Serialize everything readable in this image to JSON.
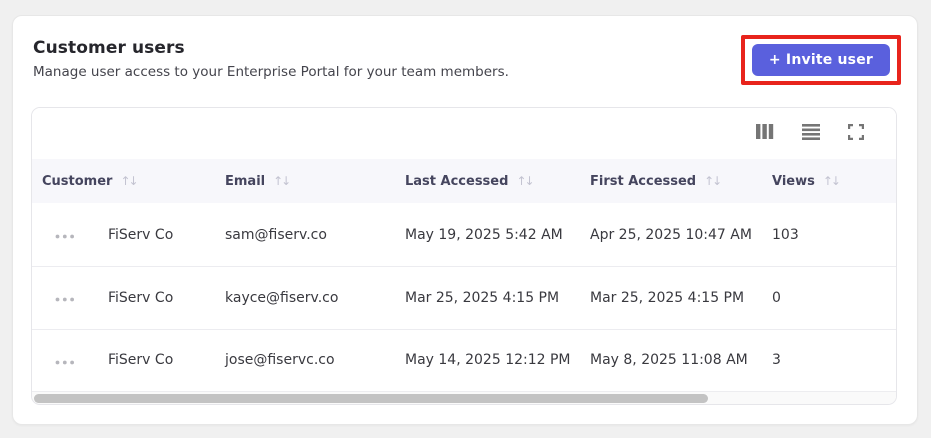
{
  "header": {
    "title": "Customer users",
    "subtitle": "Manage user access to your Enterprise Portal for your team members.",
    "invite_button_label": "+ Invite user"
  },
  "toolbar": {
    "icons": [
      "columns-icon",
      "density-icon",
      "fullscreen-icon"
    ]
  },
  "table": {
    "columns": [
      "Customer",
      "Email",
      "Last Accessed",
      "First Accessed",
      "Views"
    ],
    "sort_icon": "↑↓",
    "row_menu_icon": "ellipsis-icon",
    "rows": [
      {
        "customer": "FiServ Co",
        "email": "sam@fiserv.co",
        "last_accessed": "May 19, 2025 5:42 AM",
        "first_accessed": "Apr 25, 2025 10:47 AM",
        "views": "103"
      },
      {
        "customer": "FiServ Co",
        "email": "kayce@fiserv.co",
        "last_accessed": "Mar 25, 2025 4:15 PM",
        "first_accessed": "Mar 25, 2025 4:15 PM",
        "views": "0"
      },
      {
        "customer": "FiServ Co",
        "email": "jose@fiservc.co",
        "last_accessed": "May 14, 2025 12:12 PM",
        "first_accessed": "May 8, 2025 11:08 AM",
        "views": "3"
      }
    ]
  },
  "colors": {
    "accent": "#5a60dd",
    "annotation_highlight": "#e8241c",
    "page_background": "#f0f0f0",
    "header_row_background": "#f7f7fb"
  }
}
